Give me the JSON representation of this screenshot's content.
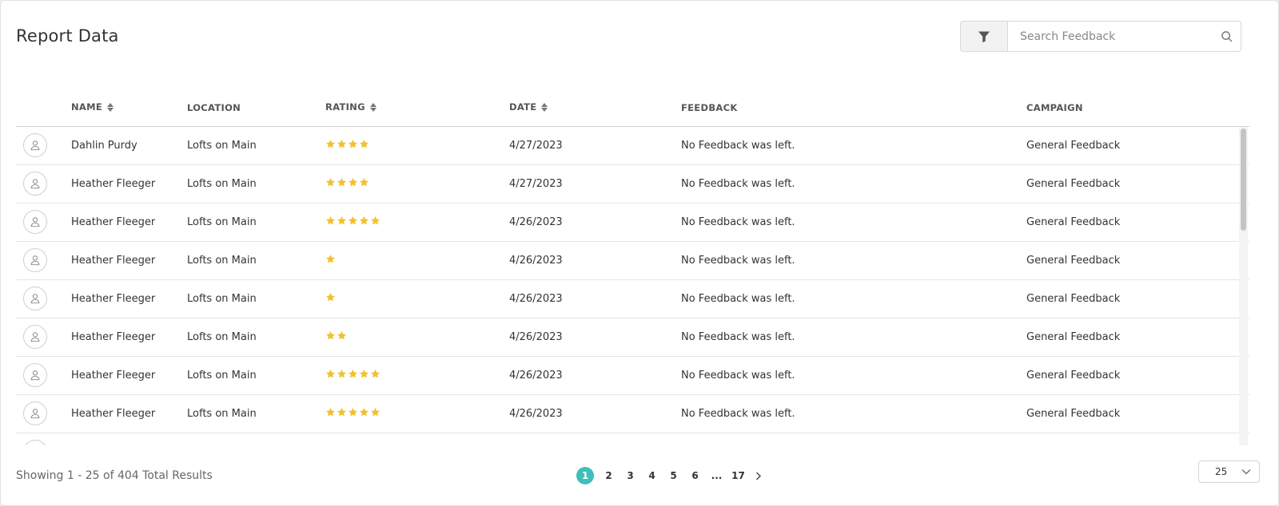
{
  "page": {
    "title": "Report Data"
  },
  "toolbar": {
    "search_placeholder": "Search Feedback"
  },
  "columns": {
    "name": "NAME",
    "location": "LOCATION",
    "rating": "RATING",
    "date": "DATE",
    "feedback": "FEEDBACK",
    "campaign": "CAMPAIGN"
  },
  "rows": [
    {
      "name": "Dahlin Purdy",
      "location": "Lofts on Main",
      "rating": 4,
      "date": "4/27/2023",
      "feedback": "No Feedback was left.",
      "campaign": "General Feedback"
    },
    {
      "name": "Heather Fleeger",
      "location": "Lofts on Main",
      "rating": 4,
      "date": "4/27/2023",
      "feedback": "No Feedback was left.",
      "campaign": "General Feedback"
    },
    {
      "name": "Heather Fleeger",
      "location": "Lofts on Main",
      "rating": 5,
      "date": "4/26/2023",
      "feedback": "No Feedback was left.",
      "campaign": "General Feedback"
    },
    {
      "name": "Heather Fleeger",
      "location": "Lofts on Main",
      "rating": 1,
      "date": "4/26/2023",
      "feedback": "No Feedback was left.",
      "campaign": "General Feedback"
    },
    {
      "name": "Heather Fleeger",
      "location": "Lofts on Main",
      "rating": 1,
      "date": "4/26/2023",
      "feedback": "No Feedback was left.",
      "campaign": "General Feedback"
    },
    {
      "name": "Heather Fleeger",
      "location": "Lofts on Main",
      "rating": 2,
      "date": "4/26/2023",
      "feedback": "No Feedback was left.",
      "campaign": "General Feedback"
    },
    {
      "name": "Heather Fleeger",
      "location": "Lofts on Main",
      "rating": 5,
      "date": "4/26/2023",
      "feedback": "No Feedback was left.",
      "campaign": "General Feedback"
    },
    {
      "name": "Heather Fleeger",
      "location": "Lofts on Main",
      "rating": 5,
      "date": "4/26/2023",
      "feedback": "No Feedback was left.",
      "campaign": "General Feedback"
    }
  ],
  "footer": {
    "results_text": "Showing 1 - 25 of 404 Total Results",
    "pages": [
      "1",
      "2",
      "3",
      "4",
      "5",
      "6",
      "...",
      "17"
    ],
    "active_page": "1",
    "per_page": "25"
  },
  "colors": {
    "accent": "#3fbfb9",
    "star": "#f2c12e",
    "text": "#333333"
  },
  "icons": {
    "filter": "filter-icon",
    "search": "search-icon",
    "avatar": "user-icon",
    "next": "chevron-right-icon",
    "dropdown": "chevron-down-icon"
  }
}
